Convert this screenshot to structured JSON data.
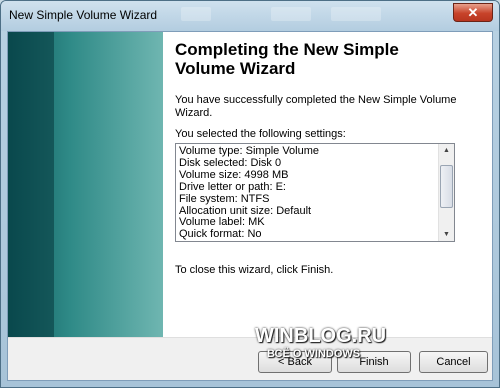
{
  "window": {
    "title": "New Simple Volume Wizard",
    "close_symbol": "✕"
  },
  "content": {
    "heading_line1": "Completing the New Simple",
    "heading_line2": "Volume Wizard",
    "success_line1": "You have successfully completed the New Simple Volume",
    "success_line2": "Wizard.",
    "settings_label": "You selected the following settings:",
    "settings": [
      "Volume type: Simple Volume",
      "Disk selected: Disk 0",
      "Volume size: 4998 MB",
      "Drive letter or path: E:",
      "File system: NTFS",
      "Allocation unit size: Default",
      "Volume label: MK",
      "Quick format: No"
    ],
    "finish_hint": "To close this wizard, click Finish."
  },
  "scrollbar": {
    "up_icon": "▲",
    "down_icon": "▼"
  },
  "buttons": {
    "back": "< Back",
    "finish": "Finish",
    "cancel": "Cancel"
  },
  "watermark": {
    "site": "WINBLOG.RU",
    "tagline": "ВСЁ О WINDOWS"
  }
}
